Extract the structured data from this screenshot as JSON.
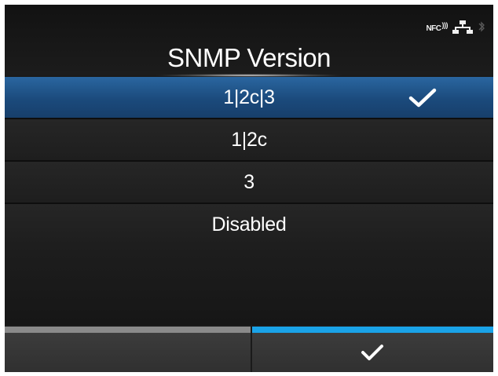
{
  "header": {
    "title": "SNMP Version",
    "status_icons": {
      "nfc_label": "NFC",
      "network_icon": "network-icon",
      "bluetooth_icon": "bluetooth-icon"
    }
  },
  "options": [
    {
      "label": "1|2c|3",
      "selected": true
    },
    {
      "label": "1|2c",
      "selected": false
    },
    {
      "label": "3",
      "selected": false
    },
    {
      "label": "Disabled",
      "selected": false
    }
  ],
  "softkeys": {
    "left": {
      "icon": "none"
    },
    "right": {
      "icon": "check-icon"
    }
  },
  "colors": {
    "selected_row": "#1f5a92",
    "accent_bar": "#1aa3e8",
    "inactive_bar": "#8a8a8a"
  }
}
